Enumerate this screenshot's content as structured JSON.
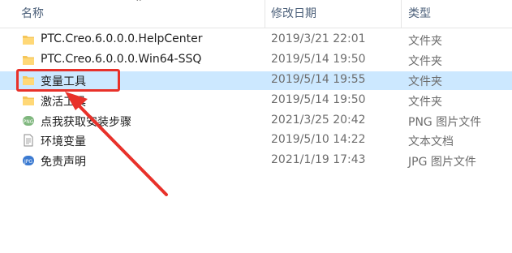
{
  "columns": {
    "name": "名称",
    "date": "修改日期",
    "type": "类型"
  },
  "rows": [
    {
      "name": "PTC.Creo.6.0.0.0.HelpCenter",
      "date": "2019/3/21 22:01",
      "type": "文件夹",
      "icon": "folder-icon"
    },
    {
      "name": "PTC.Creo.6.0.0.0.Win64-SSQ",
      "date": "2019/5/14 19:50",
      "type": "文件夹",
      "icon": "folder-icon"
    },
    {
      "name": "变量工具",
      "date": "2019/5/14 19:55",
      "type": "文件夹",
      "icon": "folder-icon",
      "selected": true
    },
    {
      "name": "激活工具",
      "date": "2019/5/14 19:50",
      "type": "文件夹",
      "icon": "folder-icon"
    },
    {
      "name": "点我获取安装步骤",
      "date": "2021/3/25 20:42",
      "type": "PNG 图片文件",
      "icon": "png-file-icon"
    },
    {
      "name": "环境变量",
      "date": "2019/5/10 14:22",
      "type": "文本文档",
      "icon": "text-file-icon"
    },
    {
      "name": "免责声明",
      "date": "2021/1/19 17:43",
      "type": "JPG 图片文件",
      "icon": "jpg-file-icon"
    }
  ],
  "colors": {
    "selection": "#cce8ff",
    "annotation": "#e8312a",
    "folder": "#f5c65a"
  }
}
